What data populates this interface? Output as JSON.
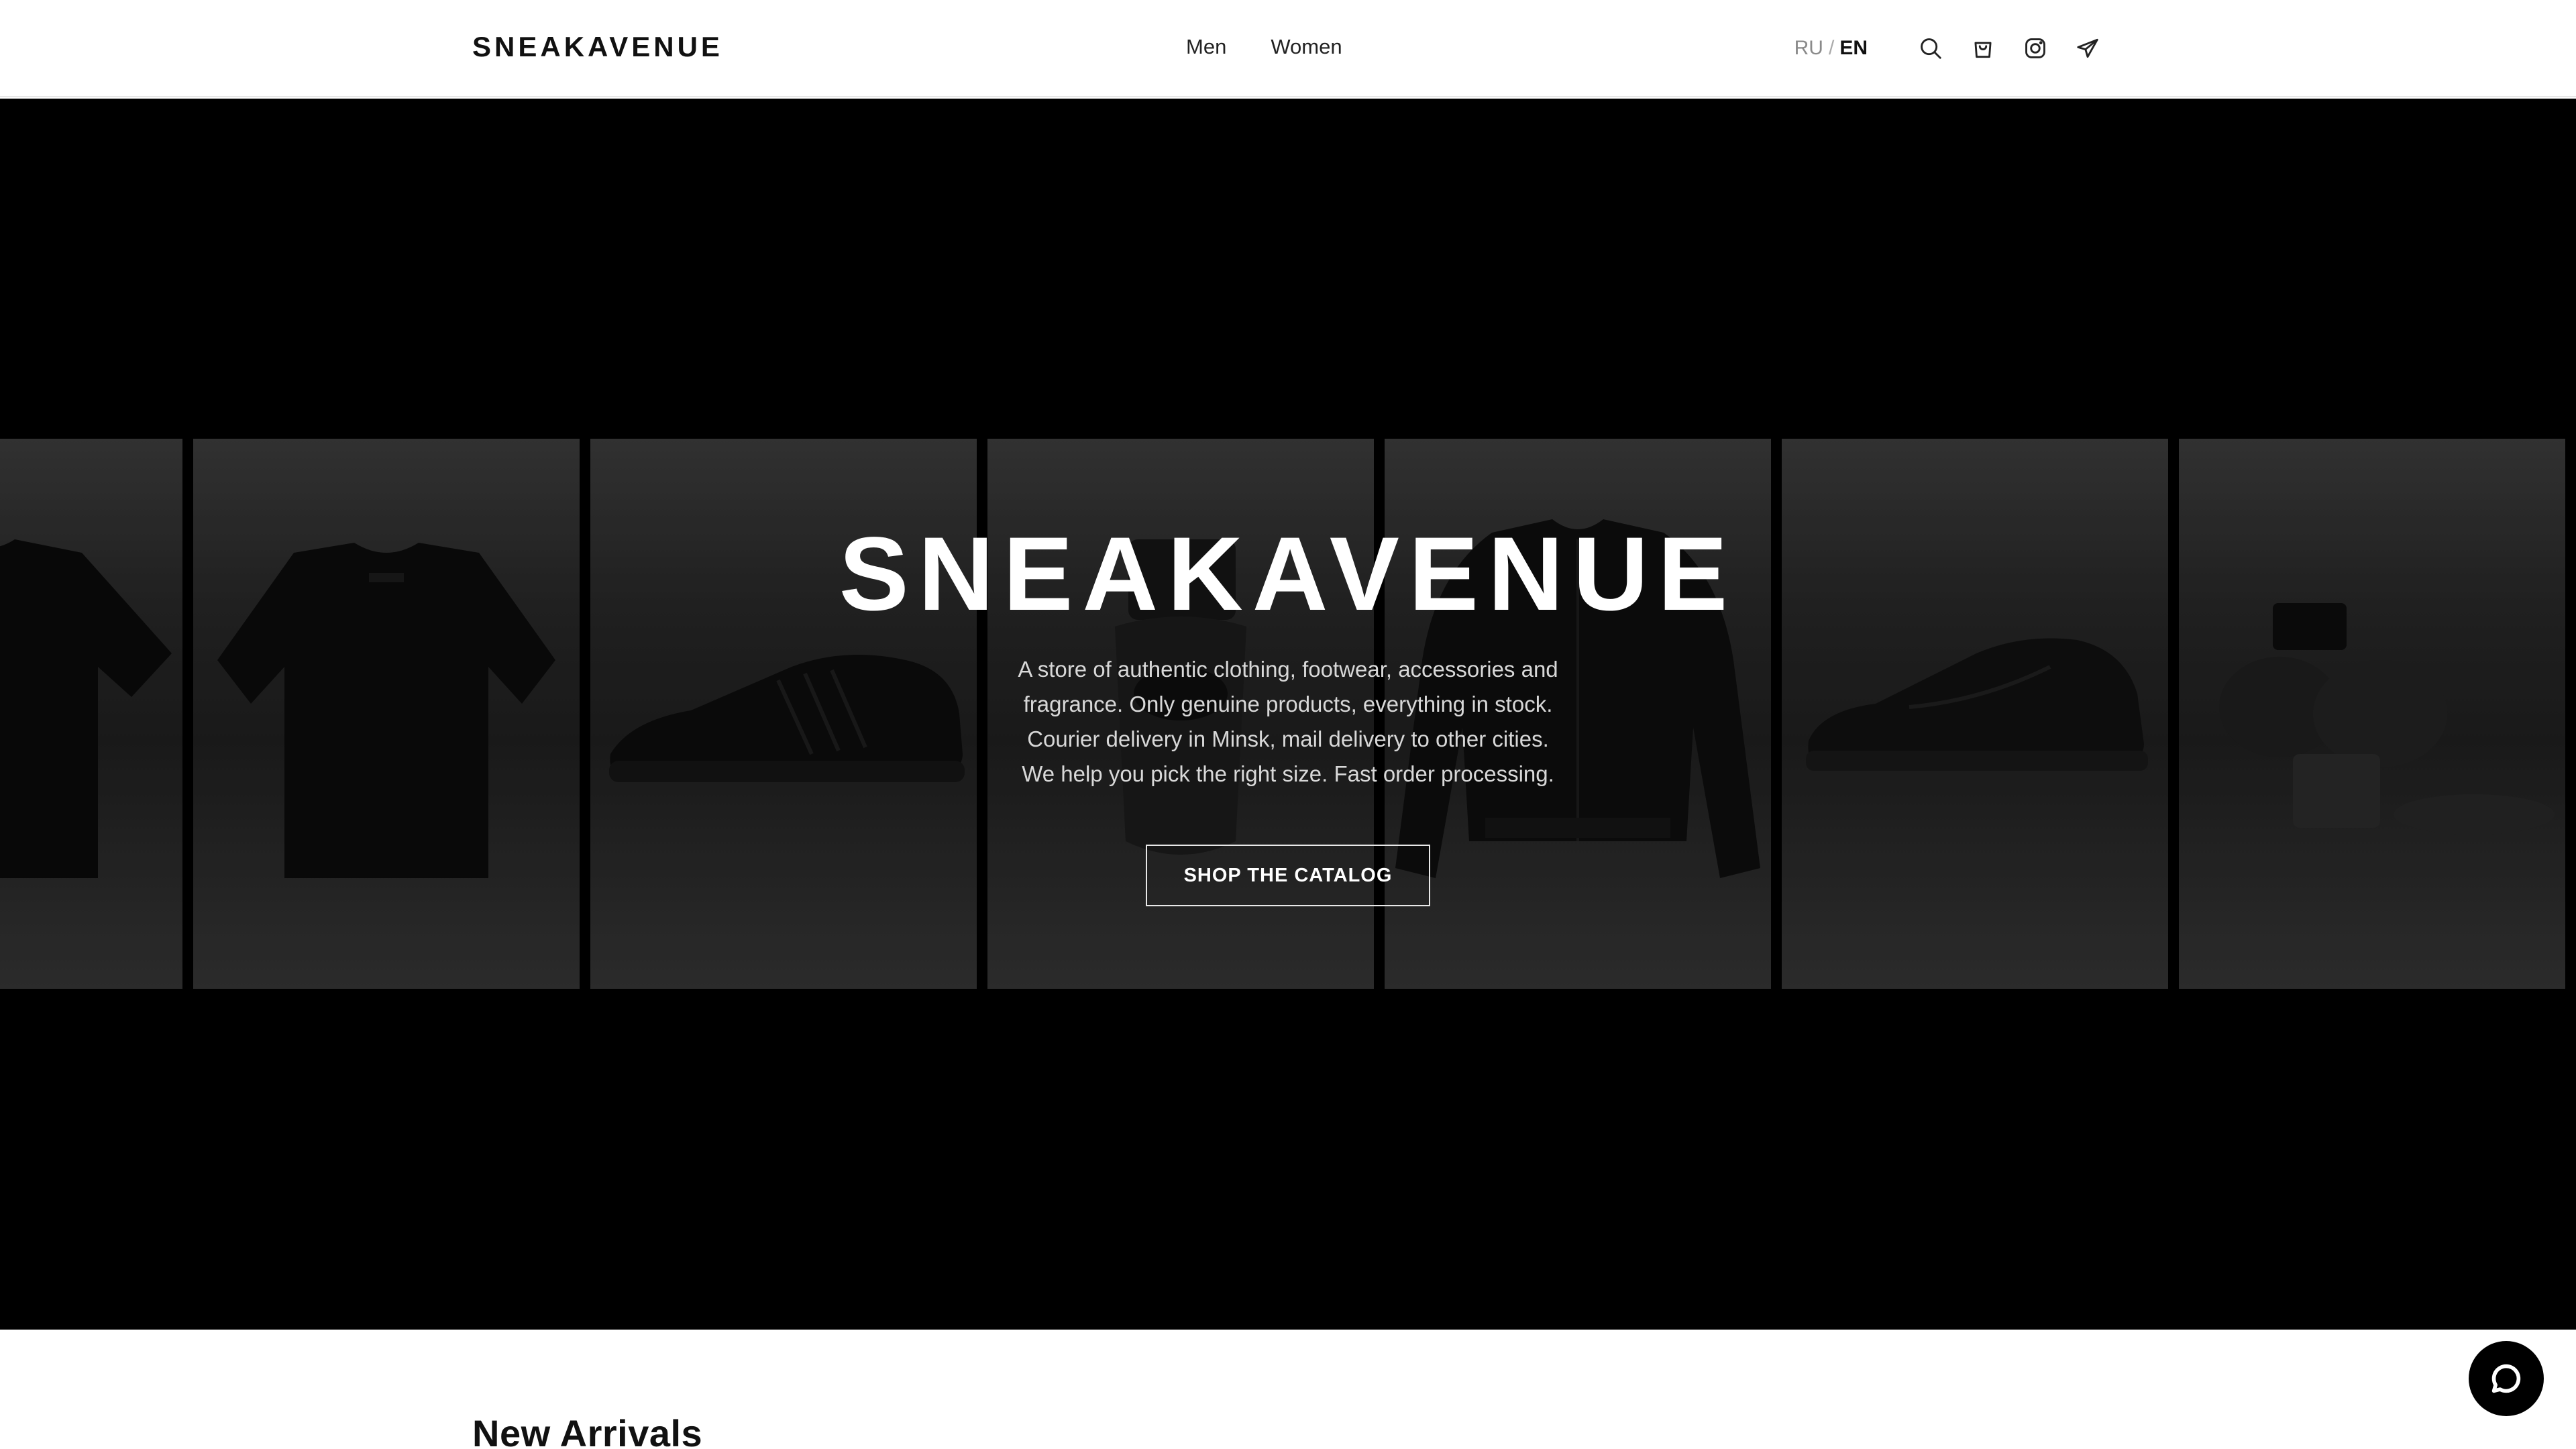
{
  "header": {
    "logo": "SNEAKAVENUE",
    "nav": [
      {
        "label": "Men"
      },
      {
        "label": "Women"
      }
    ],
    "lang": {
      "ru": "RU",
      "separator": "/",
      "en": "EN",
      "active": "EN"
    },
    "icons": [
      "search-icon",
      "cart-icon",
      "instagram-icon",
      "telegram-icon"
    ]
  },
  "hero": {
    "title": "SNEAKAVENUE",
    "description": [
      "A store of authentic clothing, footwear, accessories and",
      "fragrance. Only genuine products, everything in stock.",
      "Courier delivery in Minsk, mail delivery to other cities.",
      "We help you pick the right size. Fast order processing."
    ],
    "cta": "SHOP THE CATALOG",
    "gallery": [
      "t-shirt",
      "t-shirt",
      "sneaker",
      "fragrance",
      "jacket",
      "sneaker",
      "ceramic-object"
    ]
  },
  "sections": {
    "new_arrivals": "New Arrivals"
  },
  "colors": {
    "hero_bg": "#000000",
    "panel_bg": "#2a2a2a",
    "accent": "#111111"
  },
  "chat": {
    "icon": "chat-bubble-icon"
  }
}
